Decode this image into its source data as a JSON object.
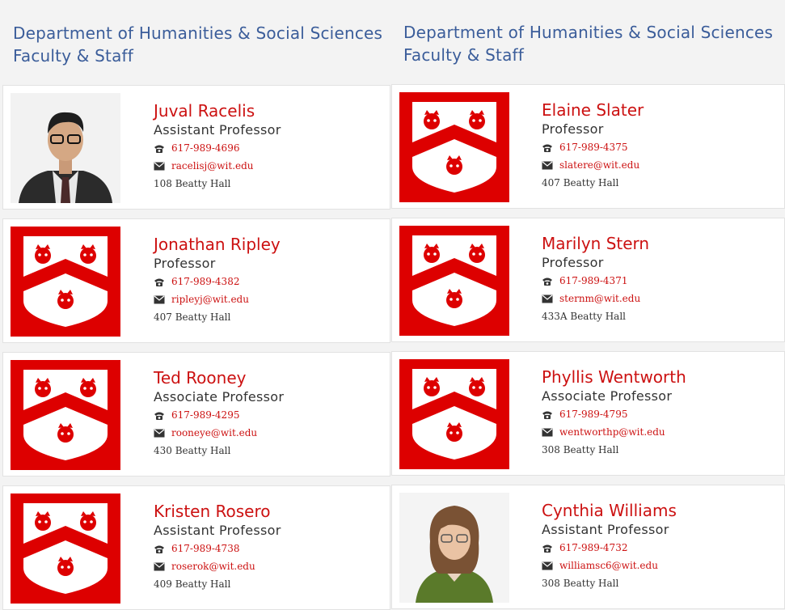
{
  "heading": {
    "line1": "Department of Humanities & Social Sciences",
    "line2": "Faculty & Staff"
  },
  "colors": {
    "accent": "#cc1111",
    "heading": "#3b5d9a",
    "crest_red": "#dd0000"
  },
  "left": [
    {
      "name": "Juval Racelis",
      "title": "Assistant Professor",
      "phone": "617-989-4696",
      "email": "racelisj@wit.edu",
      "office": "108 Beatty Hall",
      "photo": "person-photo"
    },
    {
      "name": "Jonathan Ripley",
      "title": "Professor",
      "phone": "617-989-4382",
      "email": "ripleyj@wit.edu",
      "office": "407 Beatty Hall",
      "photo": "crest"
    },
    {
      "name": "Ted Rooney",
      "title": "Associate Professor",
      "phone": "617-989-4295",
      "email": "rooneye@wit.edu",
      "office": "430 Beatty Hall",
      "photo": "crest"
    },
    {
      "name": "Kristen Rosero",
      "title": "Assistant Professor",
      "phone": "617-989-4738",
      "email": "roserok@wit.edu",
      "office": "409 Beatty Hall",
      "photo": "crest"
    }
  ],
  "right": [
    {
      "name": "Elaine Slater",
      "title": "Professor",
      "phone": "617-989-4375",
      "email": "slatere@wit.edu",
      "office": "407 Beatty Hall",
      "photo": "crest"
    },
    {
      "name": "Marilyn Stern",
      "title": "Professor",
      "phone": "617-989-4371",
      "email": "sternm@wit.edu",
      "office": "433A Beatty Hall",
      "photo": "crest"
    },
    {
      "name": "Phyllis Wentworth",
      "title": "Associate Professor",
      "phone": "617-989-4795",
      "email": "wentworthp@wit.edu",
      "office": "308 Beatty Hall",
      "photo": "crest"
    },
    {
      "name": "Cynthia Williams",
      "title": "Assistant Professor",
      "phone": "617-989-4732",
      "email": "williamsc6@wit.edu",
      "office": "308 Beatty Hall",
      "photo": "person-photo"
    }
  ]
}
